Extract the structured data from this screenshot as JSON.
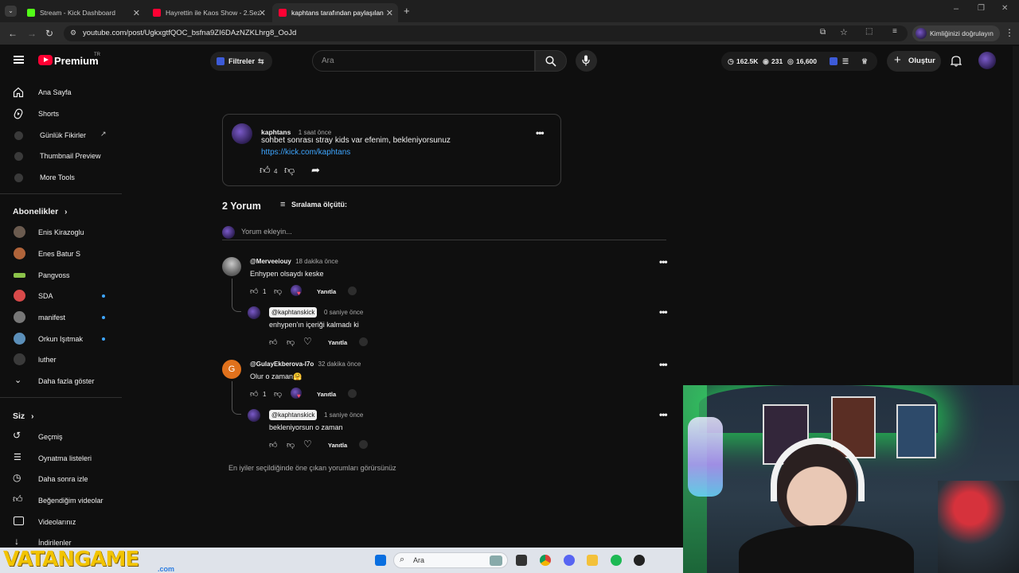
{
  "browser": {
    "tabs": [
      {
        "title": "Stream - Kick Dashboard",
        "color": "#53fc18"
      },
      {
        "title": "Hayrettin ile Kaos Show - 2.Sez",
        "color": "#ff0033"
      },
      {
        "title": "kaphtans tarafından paylaşılan",
        "color": "#ff0033"
      }
    ],
    "url": "youtube.com/post/UgkxgtfQOC_bsfna9ZI6DAzNZKLhrg8_OoJd",
    "verify_label": "Kimliğinizi doğrulayın"
  },
  "header": {
    "logo": "Premium",
    "logo_region": "TR",
    "filters_label": "Filtreler",
    "search_placeholder": "Ara",
    "stats": {
      "views": "162.5K",
      "watching": "231",
      "subs": "16,600"
    },
    "create_label": "Oluştur"
  },
  "sidebar": {
    "main": [
      {
        "label": "Ana Sayfa",
        "icon": "home-icon"
      },
      {
        "label": "Shorts",
        "icon": "shorts-icon"
      },
      {
        "label": "Günlük Fikirler",
        "icon": "extension-icon"
      },
      {
        "label": "Thumbnail Preview",
        "icon": "extension-icon"
      },
      {
        "label": "More Tools",
        "icon": "extension-icon"
      }
    ],
    "subs_header": "Abonelikler",
    "subs": [
      {
        "label": "Enis Kirazoglu",
        "color": "#6b5b4f",
        "live": false
      },
      {
        "label": "Enes Batur S",
        "color": "#b0643a",
        "live": false
      },
      {
        "label": "Pangvoss",
        "color": "#8bc34a",
        "live": false
      },
      {
        "label": "SDA",
        "color": "#d84a4a",
        "live": true
      },
      {
        "label": "manifest",
        "color": "#777777",
        "live": true
      },
      {
        "label": "Orkun Işıtmak",
        "color": "#5b8fb9",
        "live": true
      },
      {
        "label": "luther",
        "color": "#3a3a3a",
        "live": false
      }
    ],
    "show_more": "Daha fazla göster",
    "you_header": "Siz",
    "you": [
      {
        "label": "Geçmiş",
        "icon": "history-icon"
      },
      {
        "label": "Oynatma listeleri",
        "icon": "playlist-icon"
      },
      {
        "label": "Daha sonra izle",
        "icon": "clock-icon"
      },
      {
        "label": "Beğendiğim videolar",
        "icon": "like-icon"
      },
      {
        "label": "Videolarınız",
        "icon": "video-icon"
      },
      {
        "label": "İndirilenler",
        "icon": "download-icon"
      }
    ]
  },
  "post": {
    "author": "kaphtans",
    "time": "1 saat önce",
    "text": "sohbet sonrası stray kids var efenim, bekleniyorsunuz",
    "link": "https://kick.com/kaphtans",
    "likes": "4"
  },
  "comments_section": {
    "count_label": "2 Yorum",
    "sort_label": "Sıralama ölçütü:",
    "add_placeholder": "Yorum ekleyin...",
    "reply_label": "Yanıtla",
    "footer_note": "En iyiler seçildiğinde öne çıkan yorumları görürsünüz",
    "comments": [
      {
        "user": "@Merveeiouy",
        "time": "18 dakika önce",
        "text": "Enhypen olsaydı keske",
        "likes": "1",
        "reply": {
          "user": "@kaphtanskick",
          "time": "0 saniye önce",
          "text": "enhypen'ın içeriği kalmadı ki"
        }
      },
      {
        "user": "@GulayEkberova-l7o",
        "time": "32 dakika önce",
        "text": "Olur o zaman🤗",
        "likes": "1",
        "initial": "G",
        "reply": {
          "user": "@kaphtanskick",
          "time": "1 saniye önce",
          "text": "bekleniyorsun o zaman"
        }
      }
    ]
  },
  "taskbar": {
    "watermark": "VATANGAME",
    "watermark_sub": ".com",
    "search_label": "Ara"
  }
}
